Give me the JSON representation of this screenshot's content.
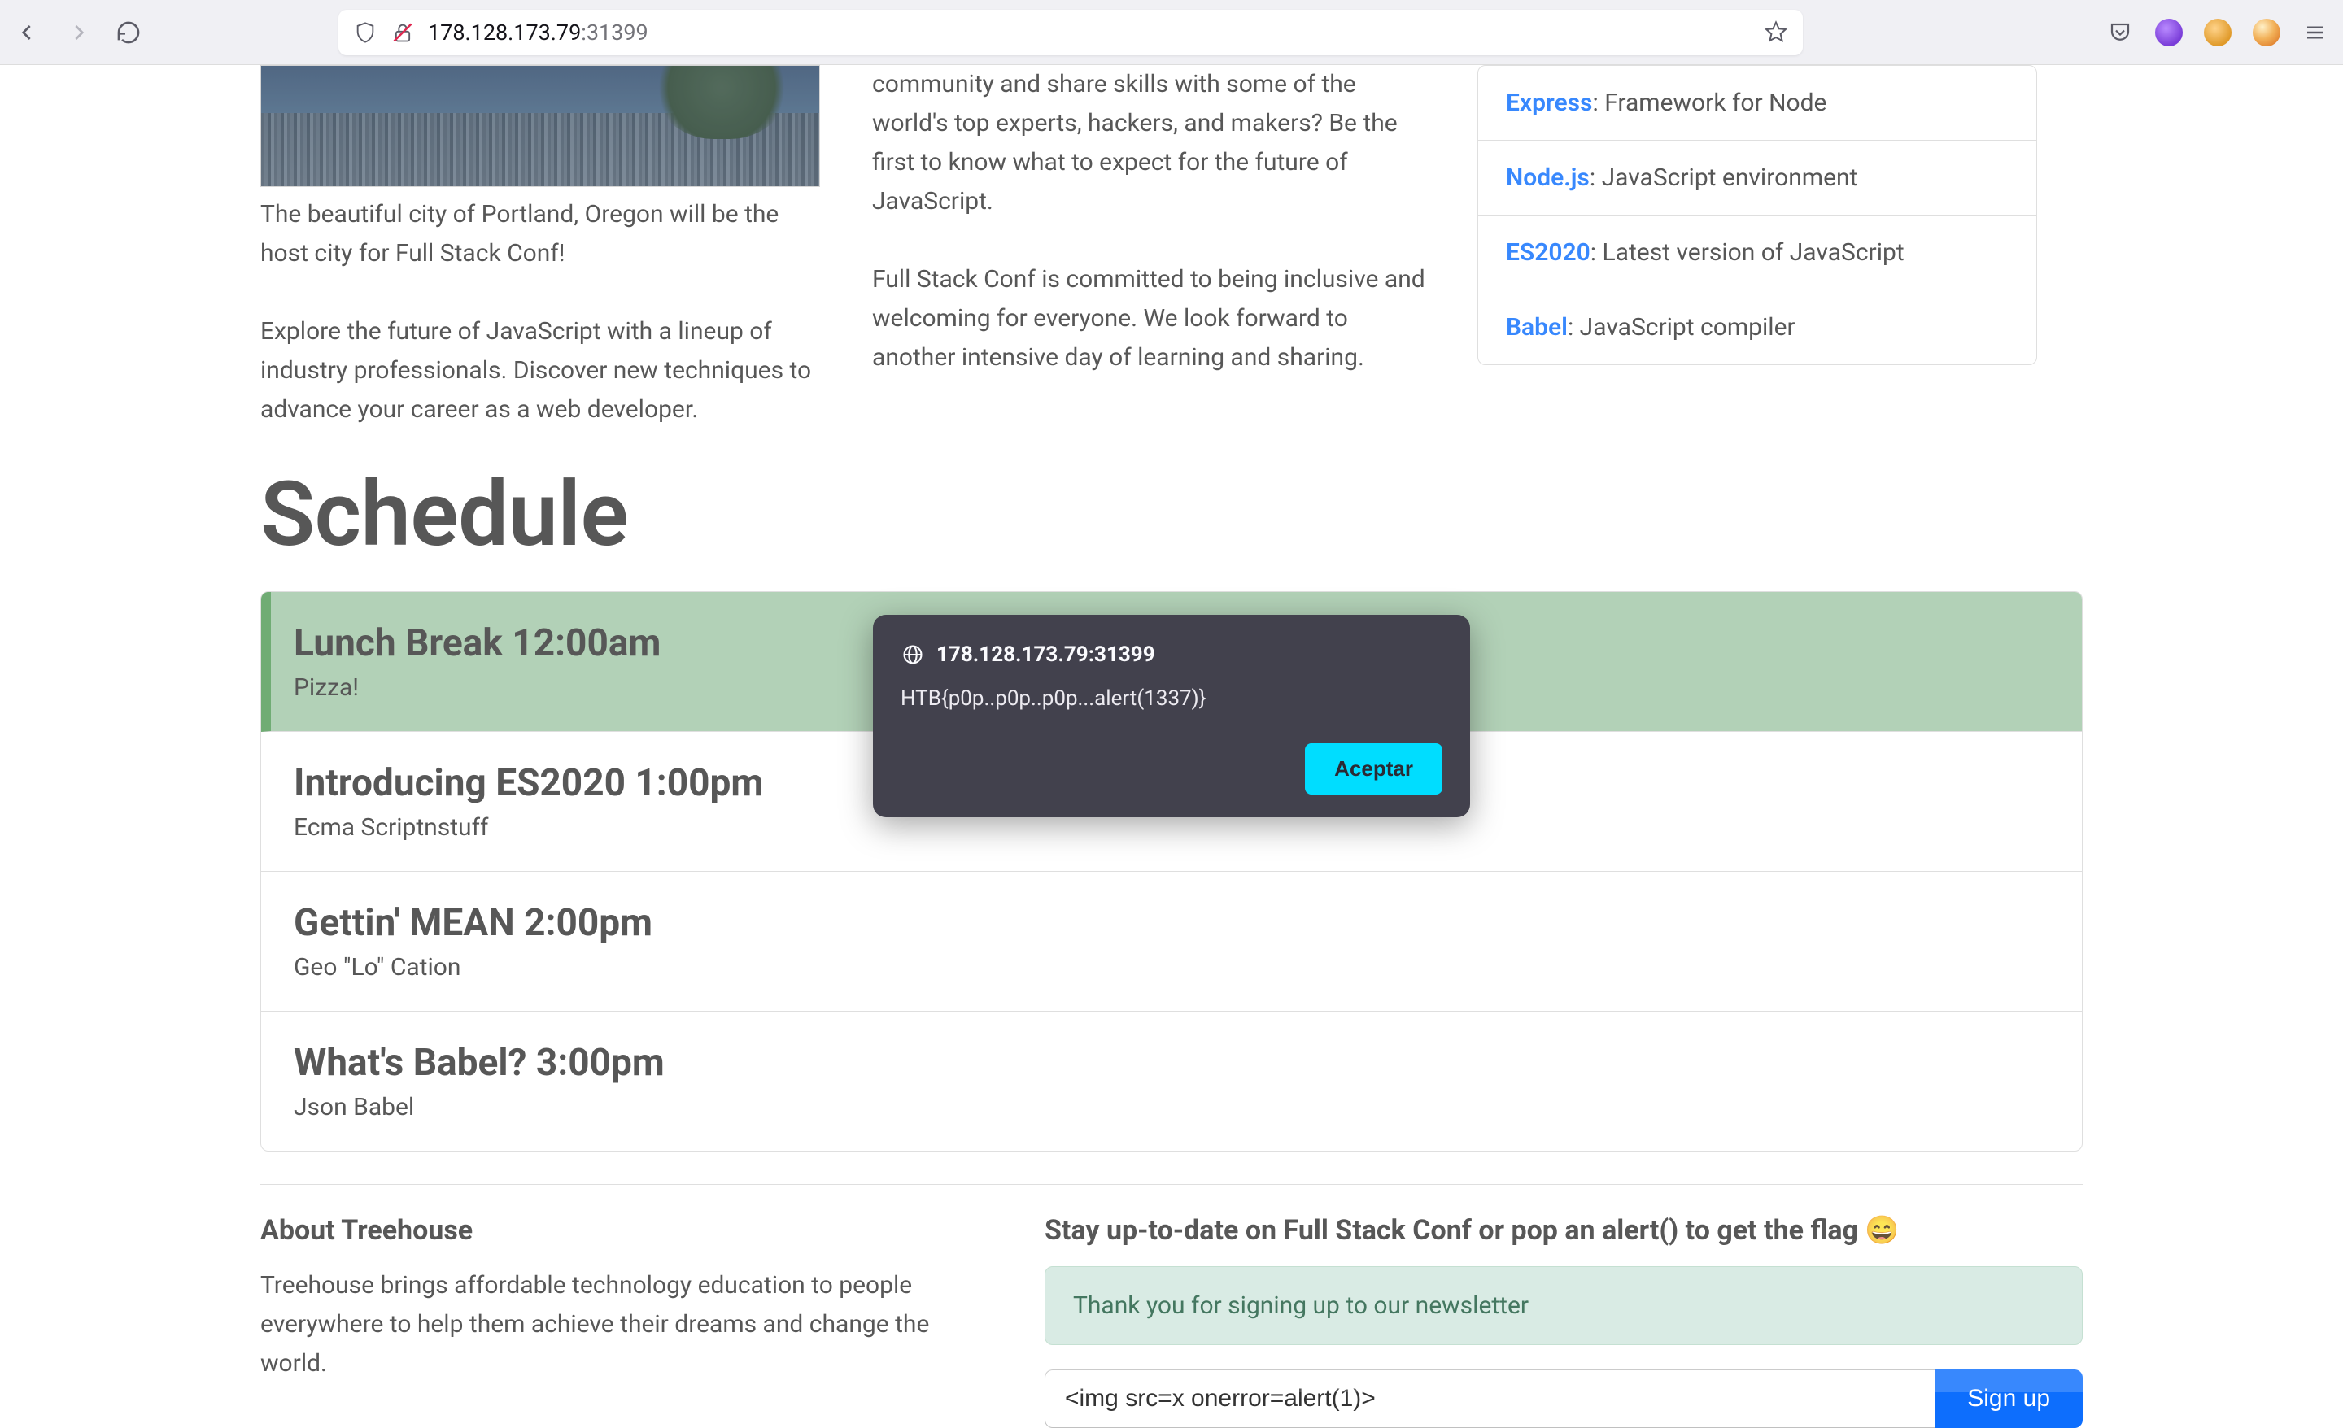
{
  "browser": {
    "url_host": "178.128.173.79",
    "url_port": ":31399"
  },
  "hero": {
    "caption": "The beautiful city of Portland, Oregon will be the host city for Full Stack Conf!",
    "para_left": "Explore the future of JavaScript with a lineup of industry professionals. Discover new techniques to advance your career as a web developer.",
    "para_mid_1": "community and share skills with some of the world's top experts, hackers, and makers? Be the first to know what to expect for the future of JavaScript.",
    "para_mid_2": "Full Stack Conf is committed to being inclusive and welcoming for everyone. We look forward to another intensive day of learning and sharing."
  },
  "tech": [
    {
      "name": "Express",
      "desc": ": Framework for Node"
    },
    {
      "name": "Node.js",
      "desc": ": JavaScript environment"
    },
    {
      "name": "ES2020",
      "desc": ": Latest version of JavaScript"
    },
    {
      "name": "Babel",
      "desc": ": JavaScript compiler"
    }
  ],
  "schedule_heading": "Schedule",
  "schedule": [
    {
      "title": "Lunch Break 12:00am",
      "sub": "Pizza!",
      "lunch": true
    },
    {
      "title": "Introducing ES2020 1:00pm",
      "sub": "Ecma Scriptnstuff"
    },
    {
      "title": "Gettin' MEAN 2:00pm",
      "sub": "Geo \"Lo\" Cation"
    },
    {
      "title": "What's Babel? 3:00pm",
      "sub": "Json Babel"
    }
  ],
  "footer": {
    "about_title": "About Treehouse",
    "about_para": "Treehouse brings affordable technology education to people everywhere to help them achieve their dreams and change the world.",
    "signup_title": "Stay up-to-date on Full Stack Conf or pop an alert() to get the flag 😄",
    "success_msg": "Thank you for signing up to our newsletter",
    "input_value": "<img src=x onerror=alert(1)>",
    "signup_btn": "Sign up"
  },
  "alert": {
    "origin": "178.128.173.79:31399",
    "message": "HTB{p0p..p0p..p0p...alert(1337)}",
    "accept": "Aceptar"
  }
}
